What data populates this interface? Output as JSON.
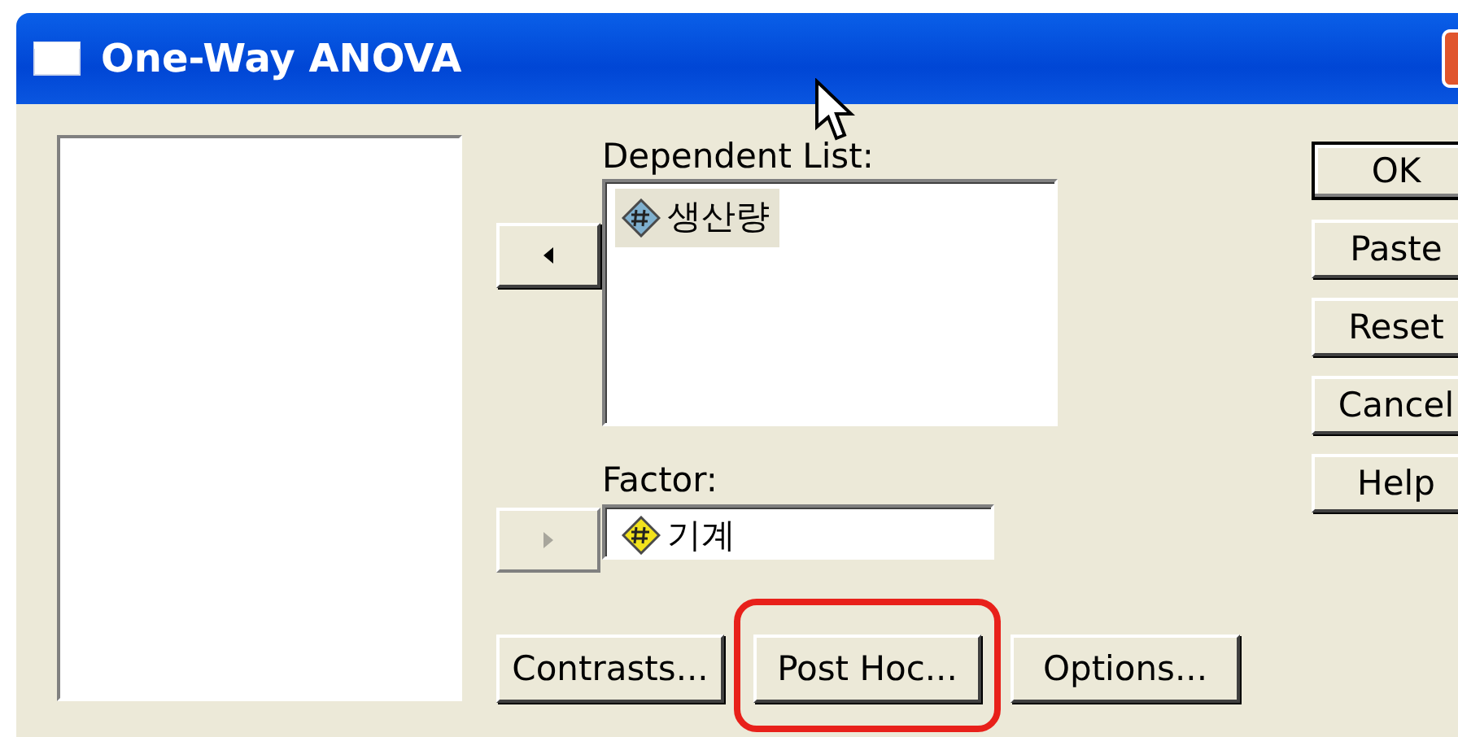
{
  "window": {
    "title": "One-Way ANOVA"
  },
  "move_buttons": [
    {
      "kind": "left",
      "disabled": false
    },
    {
      "kind": "right",
      "disabled": true
    }
  ],
  "dependent_list": {
    "label": "Dependent List:",
    "items": [
      {
        "text": "생산량",
        "kind": "scale",
        "selected": true
      }
    ]
  },
  "factor": {
    "label": "Factor:",
    "items": [
      {
        "text": "기계",
        "kind": "nominal",
        "selected": false
      }
    ]
  },
  "side_buttons": [
    {
      "label": "OK",
      "default": true
    },
    {
      "label": "Paste",
      "default": false
    },
    {
      "label": "Reset",
      "default": false
    },
    {
      "label": "Cancel",
      "default": false
    },
    {
      "label": "Help",
      "default": false
    }
  ],
  "bottom_buttons": [
    {
      "label": "Contrasts...",
      "highlighted": false
    },
    {
      "label": "Post Hoc...",
      "highlighted": true
    },
    {
      "label": "Options...",
      "highlighted": false
    }
  ]
}
